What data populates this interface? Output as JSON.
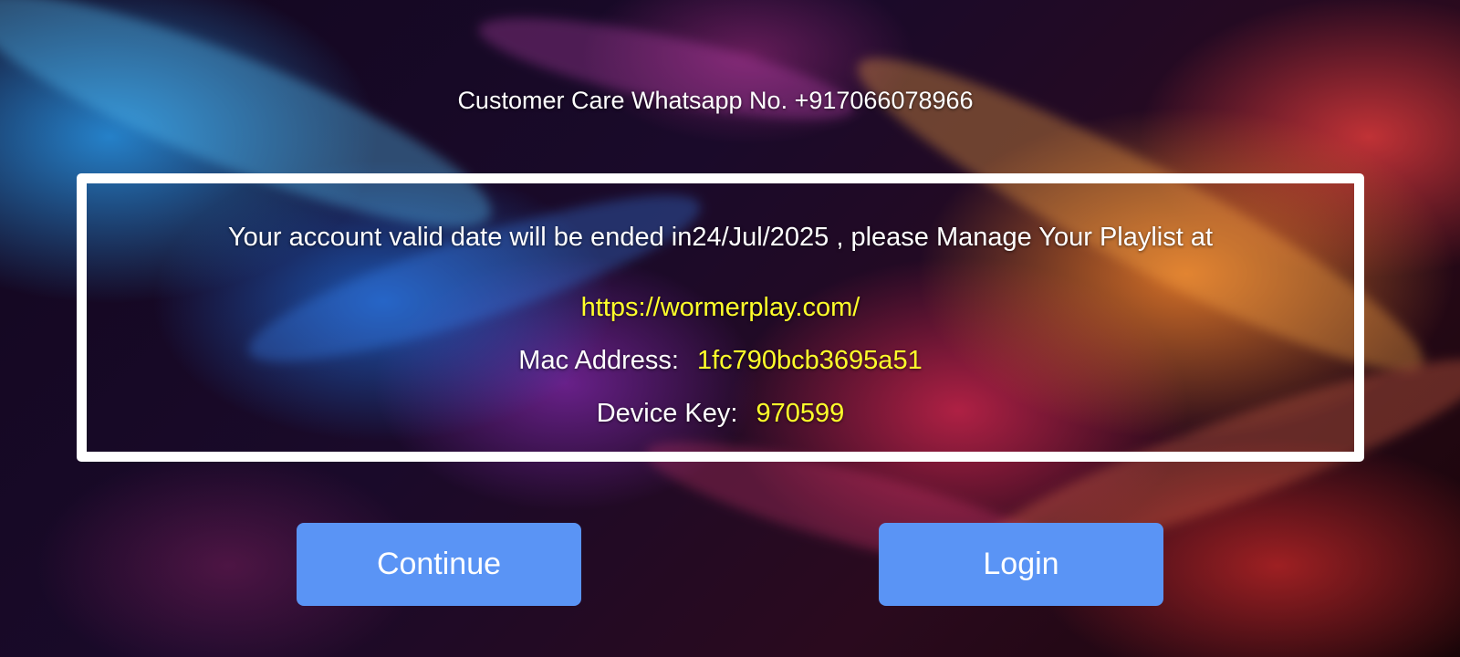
{
  "header": {
    "customer_care": "Customer Care Whatsapp No. +917066078966"
  },
  "panel": {
    "message": "Your account valid date will be ended in24/Jul/2025 , please Manage Your Playlist at",
    "url": "https://wormerplay.com/",
    "mac_label": "Mac Address:",
    "mac_value": "1fc790bcb3695a51",
    "key_label": "Device Key:",
    "key_value": "970599"
  },
  "buttons": {
    "continue_label": "Continue",
    "login_label": "Login"
  },
  "colors": {
    "accent_yellow": "#ffff2a",
    "button_blue": "#5a94f5",
    "text_white": "#ffffff"
  }
}
